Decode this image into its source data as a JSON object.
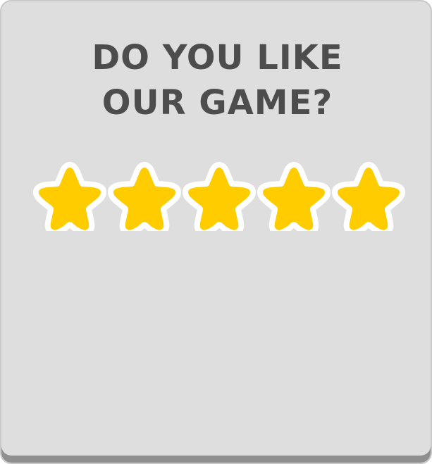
{
  "dialog": {
    "title_line1": "DO YOU LIKE",
    "title_line2": "OUR GAME?"
  },
  "rating": {
    "max": 5,
    "value": 5,
    "stars": [
      {
        "label": "star-1",
        "filled": true
      },
      {
        "label": "star-2",
        "filled": true
      },
      {
        "label": "star-3",
        "filled": true
      },
      {
        "label": "star-4",
        "filled": true
      },
      {
        "label": "star-5",
        "filled": true
      }
    ]
  },
  "colors": {
    "panel": "#dedede",
    "panel_shadow": "#8f8f8f",
    "title": "#4d4d4d",
    "star_fill": "#ffcc00",
    "star_outline": "#ffffff"
  },
  "icons": {
    "star": "star-icon"
  }
}
